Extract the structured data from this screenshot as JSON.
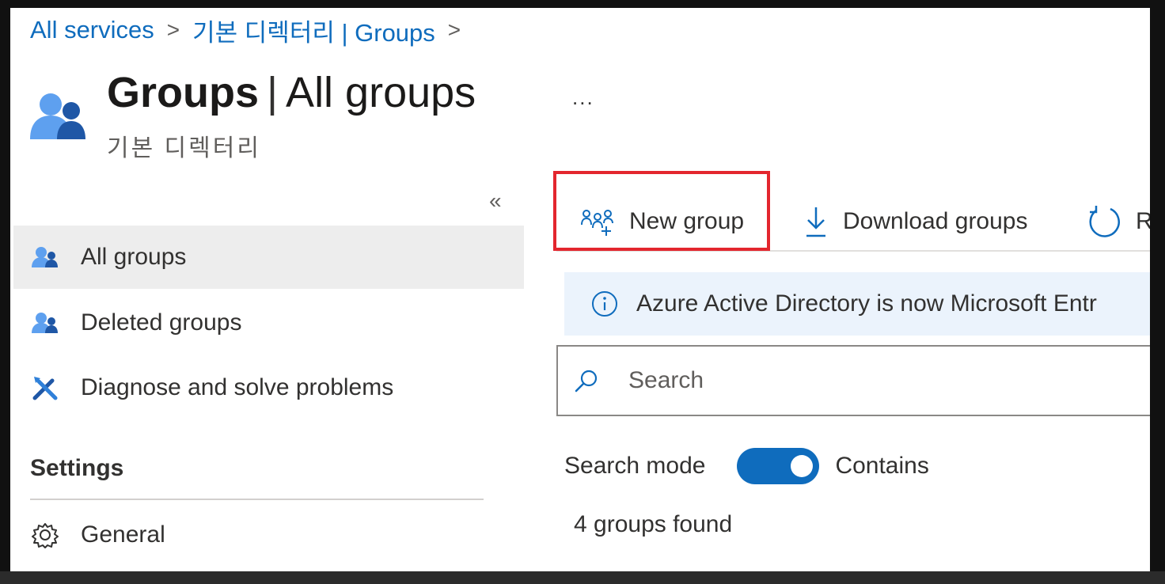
{
  "breadcrumb": {
    "items": [
      "All services",
      "기본 디렉터리 | Groups"
    ],
    "separator": ">"
  },
  "header": {
    "title_bold": "Groups",
    "title_rest": "All groups",
    "title_divider": "|",
    "subtitle": "기본 디렉터리",
    "more": "..."
  },
  "sidebar": {
    "collapse": "«",
    "items": [
      {
        "label": "All groups",
        "icon": "groups-icon",
        "active": true
      },
      {
        "label": "Deleted groups",
        "icon": "groups-icon",
        "active": false
      },
      {
        "label": "Diagnose and solve problems",
        "icon": "wrench-screwdriver-icon",
        "active": false
      }
    ],
    "settings_heading": "Settings",
    "settings_items": [
      {
        "label": "General",
        "icon": "gear-icon"
      }
    ]
  },
  "toolbar": {
    "new_group": "New group",
    "download_groups": "Download groups",
    "refresh": "Re"
  },
  "info": {
    "text": "Azure Active Directory is now Microsoft Entr"
  },
  "search": {
    "placeholder": "Search",
    "mode_label": "Search mode",
    "mode_value": "Contains"
  },
  "results": {
    "count_text": "4 groups found"
  },
  "colors": {
    "link": "#0f6cbd",
    "highlight": "#e3262e",
    "active_nav": "#ededed",
    "info_bg": "#ebf3fc"
  }
}
